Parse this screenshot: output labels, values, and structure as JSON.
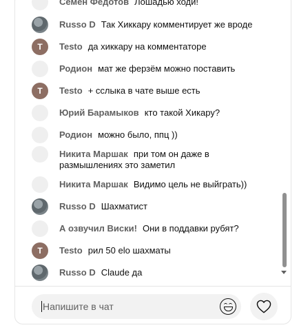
{
  "messages": [
    {
      "author": "Семен Федотов",
      "text": "Лошадью ходи!",
      "avatar": "blank"
    },
    {
      "author": "Russo D",
      "text": "Так Хиккару комментирует же вроде",
      "avatar": "photo"
    },
    {
      "author": "Testo",
      "text": "да хиккару на комментаторе",
      "avatar": "letter",
      "avatar_letter": "T"
    },
    {
      "author": "Родион",
      "text": "мат же ферзём можно поставить",
      "avatar": "blank"
    },
    {
      "author": "Testo",
      "text": "+ сслыка в чате выше есть",
      "avatar": "letter",
      "avatar_letter": "T"
    },
    {
      "author": "Юрий Барамыков",
      "text": "кто такой Хикару?",
      "avatar": "blank"
    },
    {
      "author": "Родион",
      "text": "можно было, ппц ))",
      "avatar": "blank"
    },
    {
      "author": "Никита Маршак",
      "text": "при том он даже в размышлениях это заметил",
      "avatar": "blank"
    },
    {
      "author": "Никита Маршак",
      "text": "Видимо цель не выйграть))",
      "avatar": "blank"
    },
    {
      "author": "Russo D",
      "text": "Шахматист",
      "avatar": "photo"
    },
    {
      "author": "А озвучил Виски!",
      "text": "Они в поддавки рубят?",
      "avatar": "blank"
    },
    {
      "author": "Testo",
      "text": "рил 50 elo шахматы",
      "avatar": "letter",
      "avatar_letter": "T"
    },
    {
      "author": "Russo D",
      "text": "Claude да",
      "avatar": "photo"
    }
  ],
  "input": {
    "placeholder": "Напишите в чат"
  },
  "icons": {
    "emoji": "smiley-icon",
    "like": "heart-icon"
  }
}
